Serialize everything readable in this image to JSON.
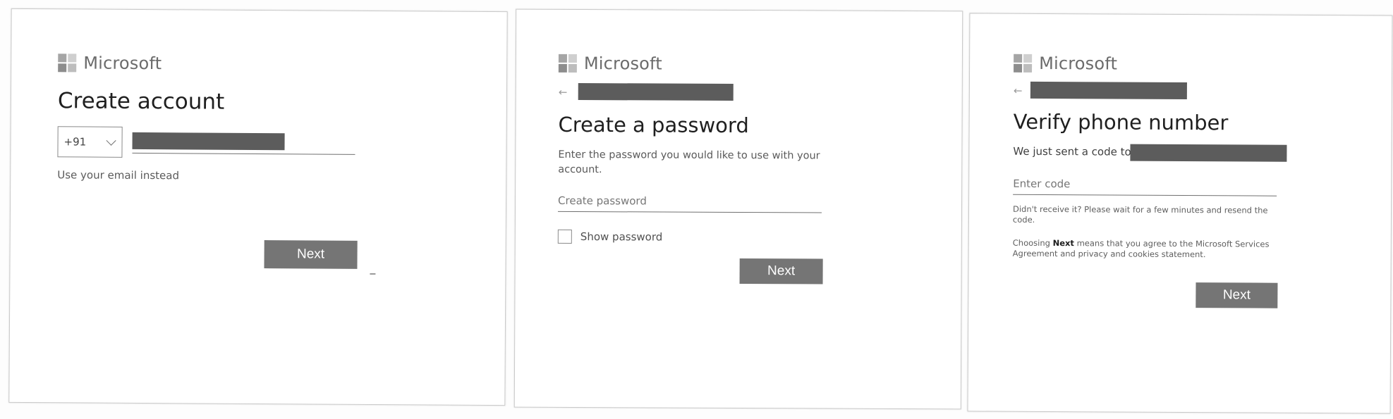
{
  "brand": {
    "name": "Microsoft"
  },
  "screens": [
    {
      "title": "Create account",
      "country_code": "+91",
      "alt_link": "Use your email instead",
      "next_label": "Next"
    },
    {
      "back_icon": "←",
      "title": "Create a password",
      "instruction": "Enter the password you would like to use with your account.",
      "password_placeholder": "Create password",
      "show_password_label": "Show password",
      "next_label": "Next"
    },
    {
      "back_icon": "←",
      "title": "Verify phone number",
      "sent_prefix": "We just sent a code to",
      "code_placeholder": "Enter code",
      "resend_note": "Didn't receive it? Please wait for a few minutes and resend the code.",
      "terms_before": "Choosing ",
      "terms_bold": "Next",
      "terms_after": " means that you agree to the Microsoft Services Agreement and privacy and cookies statement.",
      "next_label": "Next"
    }
  ]
}
